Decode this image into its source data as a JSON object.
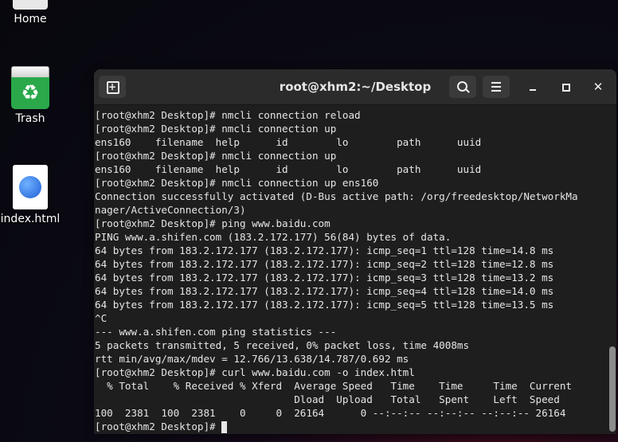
{
  "desktop": {
    "icons": [
      {
        "label": "Home",
        "icon": "folder-icon"
      },
      {
        "label": "Trash",
        "icon": "trash-icon"
      },
      {
        "label": "index.html",
        "icon": "html-file-icon"
      }
    ]
  },
  "terminal": {
    "title": "root@xhm2:~/Desktop",
    "lines": [
      "[root@xhm2 Desktop]# nmcli connection reload",
      "[root@xhm2 Desktop]# nmcli connection up",
      "ens160    filename  help      id        lo        path      uuid",
      "[root@xhm2 Desktop]# nmcli connection up",
      "ens160    filename  help      id        lo        path      uuid",
      "[root@xhm2 Desktop]# nmcli connection up ens160",
      "Connection successfully activated (D-Bus active path: /org/freedesktop/NetworkMa",
      "nager/ActiveConnection/3)",
      "[root@xhm2 Desktop]# ping www.baidu.com",
      "PING www.a.shifen.com (183.2.172.177) 56(84) bytes of data.",
      "64 bytes from 183.2.172.177 (183.2.172.177): icmp_seq=1 ttl=128 time=14.8 ms",
      "64 bytes from 183.2.172.177 (183.2.172.177): icmp_seq=2 ttl=128 time=12.8 ms",
      "64 bytes from 183.2.172.177 (183.2.172.177): icmp_seq=3 ttl=128 time=13.2 ms",
      "64 bytes from 183.2.172.177 (183.2.172.177): icmp_seq=4 ttl=128 time=14.0 ms",
      "64 bytes from 183.2.172.177 (183.2.172.177): icmp_seq=5 ttl=128 time=13.5 ms",
      "^C",
      "--- www.a.shifen.com ping statistics ---",
      "5 packets transmitted, 5 received, 0% packet loss, time 4008ms",
      "rtt min/avg/max/mdev = 12.766/13.638/14.787/0.692 ms",
      "[root@xhm2 Desktop]# curl www.baidu.com -o index.html",
      "  % Total    % Received % Xferd  Average Speed   Time    Time     Time  Current",
      "                                 Dload  Upload   Total   Spent    Left  Speed",
      "100  2381  100  2381    0     0  26164      0 --:--:-- --:--:-- --:--:-- 26164",
      "[root@xhm2 Desktop]# "
    ]
  },
  "colors": {
    "terminal_bg": "#1e1e1e",
    "titlebar_bg": "#2b2b2b",
    "text": "#e6e6e6"
  }
}
